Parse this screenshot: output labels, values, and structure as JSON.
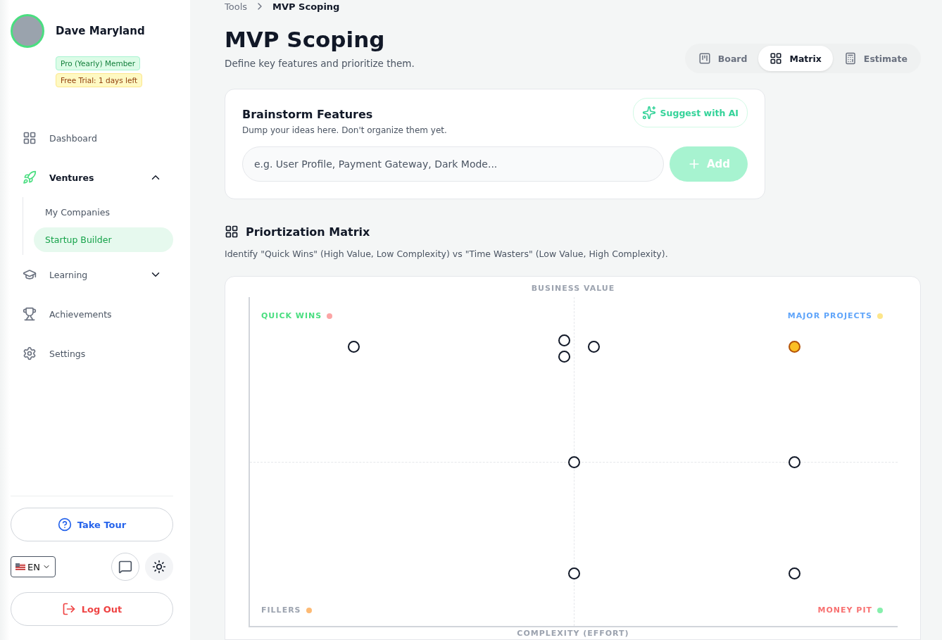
{
  "user": {
    "name": "Dave Maryland",
    "badges": [
      {
        "label": "Pro (Yearly) Member",
        "kind": "member"
      },
      {
        "label": "Free Trial: 1 days left",
        "kind": "trial"
      }
    ]
  },
  "nav": [
    {
      "label": "Dashboard",
      "selected": false
    },
    {
      "label": "Ventures",
      "expanded": true,
      "selected": true,
      "children": [
        {
          "label": "My Companies",
          "selected": false
        },
        {
          "label": "Startup Builder",
          "selected": true
        }
      ]
    },
    {
      "label": "Learning",
      "expanded": false,
      "selected": false
    },
    {
      "label": "Achievements",
      "selected": false
    },
    {
      "label": "Settings",
      "selected": false
    }
  ],
  "tour_button": "Take Tour",
  "language": "EN",
  "logout_button": "Log Out",
  "breadcrumb": [
    "Tools",
    "MVP Scoping"
  ],
  "page": {
    "title": "MVP Scoping",
    "subtitle": "Define key features and prioritize them."
  },
  "views": [
    {
      "label": "Board",
      "selected": false
    },
    {
      "label": "Matrix",
      "selected": true
    },
    {
      "label": "Estimate",
      "selected": false
    }
  ],
  "brainstorm": {
    "title": "Brainstorm Features",
    "subtitle": "Dump your ideas here. Don't organize them yet.",
    "suggest_button": "Suggest with AI",
    "placeholder": "e.g. User Profile, Payment Gateway, Dark Mode...",
    "add_button": "Add",
    "add_disabled": true
  },
  "matrix": {
    "title": "Priortization Matrix",
    "description": "Identify \"Quick Wins\" (High Value, Low Complexity) vs \"Time Wasters\" (Low Value, High Complexity).",
    "y_axis": "BUSINESS VALUE",
    "x_axis": "COMPLEXITY (EFFORT)",
    "quadrants": [
      {
        "label": "QUICK WINS",
        "color": "#4ade80"
      },
      {
        "label": "MAJOR PROJECTS",
        "color": "#60a5fa"
      },
      {
        "label": "FILLERS",
        "color": "#9ca3af"
      },
      {
        "label": "MONEY PIT",
        "color": "#f87171"
      }
    ],
    "points": [
      {
        "selected": false
      },
      {
        "selected": false
      },
      {
        "selected": false
      },
      {
        "selected": false
      },
      {
        "selected": true
      },
      {
        "selected": false
      },
      {
        "selected": false
      },
      {
        "selected": false
      },
      {
        "selected": false
      }
    ]
  }
}
